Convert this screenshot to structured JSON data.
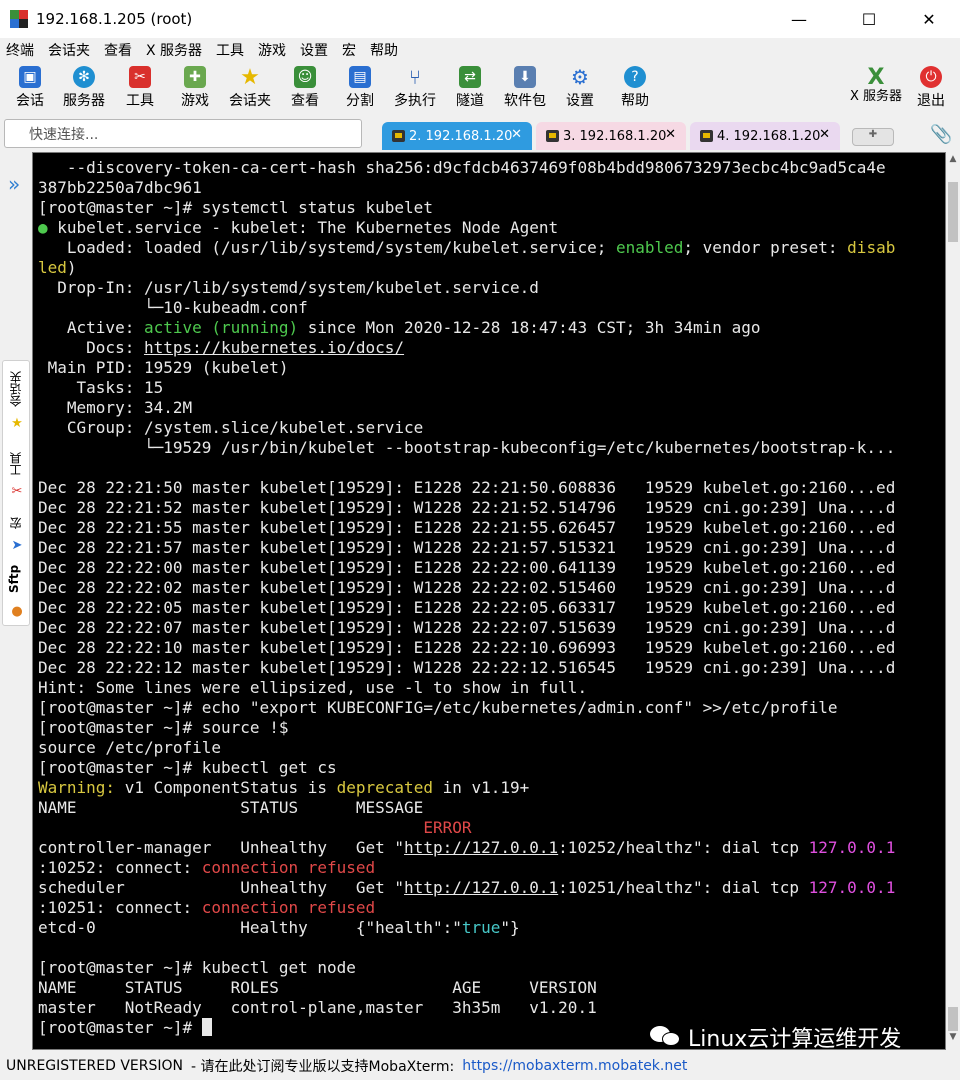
{
  "window": {
    "title": "192.168.1.205 (root)",
    "minimize": "—",
    "maximize": "☐",
    "close": "✕"
  },
  "menu": [
    "终端",
    "会话夹",
    "查看",
    "X 服务器",
    "工具",
    "游戏",
    "设置",
    "宏",
    "帮助"
  ],
  "toolbar": [
    {
      "label": "会话",
      "icon": "session-icon",
      "color": "#2a6fd1"
    },
    {
      "label": "服务器",
      "icon": "servers-icon",
      "color": "#1f8fd1"
    },
    {
      "label": "工具",
      "icon": "tools-icon",
      "color": "#d9302c"
    },
    {
      "label": "游戏",
      "icon": "games-icon",
      "color": "#6aa84f"
    },
    {
      "label": "会话夹",
      "icon": "star-icon",
      "color": "#e6b800"
    },
    {
      "label": "查看",
      "icon": "view-icon",
      "color": "#3a8f3a"
    },
    {
      "label": "分割",
      "icon": "split-icon",
      "color": "#2a6fd1"
    },
    {
      "label": "多执行",
      "icon": "multiexec-icon",
      "color": "#2a5fb1"
    },
    {
      "label": "隧道",
      "icon": "tunnel-icon",
      "color": "#3a8f3a"
    },
    {
      "label": "软件包",
      "icon": "packages-icon",
      "color": "#5a7fb1"
    },
    {
      "label": "设置",
      "icon": "settings-icon",
      "color": "#2a6fd1"
    },
    {
      "label": "帮助",
      "icon": "help-icon",
      "color": "#1f8fd1"
    }
  ],
  "toolbar_right": [
    {
      "label": "X 服务器",
      "icon": "xserver-icon",
      "color": "#3a8f3a"
    },
    {
      "label": "退出",
      "icon": "exit-icon",
      "color": "#e03030"
    }
  ],
  "quick_connect": {
    "placeholder": "快速连接..."
  },
  "tabs": [
    {
      "label": "2. 192.168.1.20",
      "close": "✕"
    },
    {
      "label": "3. 192.168.1.20",
      "close": "✕"
    },
    {
      "label": "4. 192.168.1.20",
      "close": "✕"
    }
  ],
  "sidebar": {
    "labels": [
      "会话夹",
      "工具",
      "宏",
      "Sftp"
    ]
  },
  "terminal": {
    "lines": [
      [
        {
          "t": "   --discovery-token-ca-cert-hash sha256:d9cfdcb4637469f08b4bdd9806732973ecbc4bc9ad5ca4e"
        }
      ],
      [
        {
          "t": "387bb2250a7dbc961"
        }
      ],
      [
        {
          "t": "[root@master ~]# systemctl status kubelet"
        }
      ],
      [
        {
          "t": "●",
          "c": "green"
        },
        {
          "t": " kubelet.service - kubelet: The Kubernetes Node Agent"
        }
      ],
      [
        {
          "t": "   Loaded: loaded (/usr/lib/systemd/system/kubelet.service; "
        },
        {
          "t": "enabled",
          "c": "green"
        },
        {
          "t": "; vendor preset: "
        },
        {
          "t": "disab",
          "c": "yellow"
        }
      ],
      [
        {
          "t": "led",
          "c": "yellow"
        },
        {
          "t": ")"
        }
      ],
      [
        {
          "t": "  Drop-In: /usr/lib/systemd/system/kubelet.service.d"
        }
      ],
      [
        {
          "t": "           └─10-kubeadm.conf"
        }
      ],
      [
        {
          "t": "   Active: "
        },
        {
          "t": "active (running)",
          "c": "green"
        },
        {
          "t": " since Mon 2020-12-28 18:47:43 CST; 3h 34min ago"
        }
      ],
      [
        {
          "t": "     Docs: "
        },
        {
          "t": "https://kubernetes.io/docs/",
          "u": true
        }
      ],
      [
        {
          "t": " Main PID: 19529 (kubelet)"
        }
      ],
      [
        {
          "t": "    Tasks: 15"
        }
      ],
      [
        {
          "t": "   Memory: 34.2M"
        }
      ],
      [
        {
          "t": "   CGroup: /system.slice/kubelet.service"
        }
      ],
      [
        {
          "t": "           └─19529 /usr/bin/kubelet --bootstrap-kubeconfig=/etc/kubernetes/bootstrap-k..."
        }
      ],
      [
        {
          "t": ""
        }
      ],
      [
        {
          "t": "Dec 28 22:21:50 master kubelet[19529]: E1228 22:21:50.608836   19529 kubelet.go:2160...ed"
        }
      ],
      [
        {
          "t": "Dec 28 22:21:52 master kubelet[19529]: W1228 22:21:52.514796   19529 cni.go:239] Una....d"
        }
      ],
      [
        {
          "t": "Dec 28 22:21:55 master kubelet[19529]: E1228 22:21:55.626457   19529 kubelet.go:2160...ed"
        }
      ],
      [
        {
          "t": "Dec 28 22:21:57 master kubelet[19529]: W1228 22:21:57.515321   19529 cni.go:239] Una....d"
        }
      ],
      [
        {
          "t": "Dec 28 22:22:00 master kubelet[19529]: E1228 22:22:00.641139   19529 kubelet.go:2160...ed"
        }
      ],
      [
        {
          "t": "Dec 28 22:22:02 master kubelet[19529]: W1228 22:22:02.515460   19529 cni.go:239] Una....d"
        }
      ],
      [
        {
          "t": "Dec 28 22:22:05 master kubelet[19529]: E1228 22:22:05.663317   19529 kubelet.go:2160...ed"
        }
      ],
      [
        {
          "t": "Dec 28 22:22:07 master kubelet[19529]: W1228 22:22:07.515639   19529 cni.go:239] Una....d"
        }
      ],
      [
        {
          "t": "Dec 28 22:22:10 master kubelet[19529]: E1228 22:22:10.696993   19529 kubelet.go:2160...ed"
        }
      ],
      [
        {
          "t": "Dec 28 22:22:12 master kubelet[19529]: W1228 22:22:12.516545   19529 cni.go:239] Una....d"
        }
      ],
      [
        {
          "t": "Hint: Some lines were ellipsized, use -l to show in full."
        }
      ],
      [
        {
          "t": "[root@master ~]# echo \"export KUBECONFIG=/etc/kubernetes/admin.conf\" >>/etc/profile"
        }
      ],
      [
        {
          "t": "[root@master ~]# source !$"
        }
      ],
      [
        {
          "t": "source /etc/profile"
        }
      ],
      [
        {
          "t": "[root@master ~]# kubectl get cs"
        }
      ],
      [
        {
          "t": "Warning:",
          "c": "yellow"
        },
        {
          "t": " v1 ComponentStatus is "
        },
        {
          "t": "deprecated",
          "c": "yellow"
        },
        {
          "t": " in v1.19+"
        }
      ],
      [
        {
          "t": "NAME                 STATUS      MESSAGE"
        }
      ],
      [
        {
          "t": "                                        "
        },
        {
          "t": "ERROR",
          "c": "red"
        }
      ],
      [
        {
          "t": "controller-manager   Unhealthy   Get \""
        },
        {
          "t": "http://127.0.0.1",
          "u": true
        },
        {
          "t": ":10252/healthz\": dial tcp "
        },
        {
          "t": "127.0.0.1",
          "c": "magenta"
        }
      ],
      [
        {
          "t": ":10252: connect: "
        },
        {
          "t": "connection refused",
          "c": "red"
        }
      ],
      [
        {
          "t": "scheduler            Unhealthy   Get \""
        },
        {
          "t": "http://127.0.0.1",
          "u": true
        },
        {
          "t": ":10251/healthz\": dial tcp "
        },
        {
          "t": "127.0.0.1",
          "c": "magenta"
        }
      ],
      [
        {
          "t": ":10251: connect: "
        },
        {
          "t": "connection refused",
          "c": "red"
        }
      ],
      [
        {
          "t": "etcd-0               Healthy     {\"health\":\""
        },
        {
          "t": "true",
          "c": "cyan"
        },
        {
          "t": "\"}"
        }
      ],
      [
        {
          "t": ""
        }
      ],
      [
        {
          "t": "[root@master ~]# kubectl get node"
        }
      ],
      [
        {
          "t": "NAME     STATUS     ROLES                  AGE     VERSION"
        }
      ],
      [
        {
          "t": "master   NotReady   control-plane,master   3h35m   v1.20.1"
        }
      ],
      [
        {
          "t": "[root@master ~]# "
        },
        {
          "cursor": true
        }
      ]
    ]
  },
  "watermark": {
    "text": "Linux云计算运维开发"
  },
  "statusbar": {
    "unregistered": "UNREGISTERED VERSION",
    "message": " -  请在此处订阅专业版以支持MobaXterm: ",
    "link": "https://mobaxterm.mobatek.net"
  }
}
